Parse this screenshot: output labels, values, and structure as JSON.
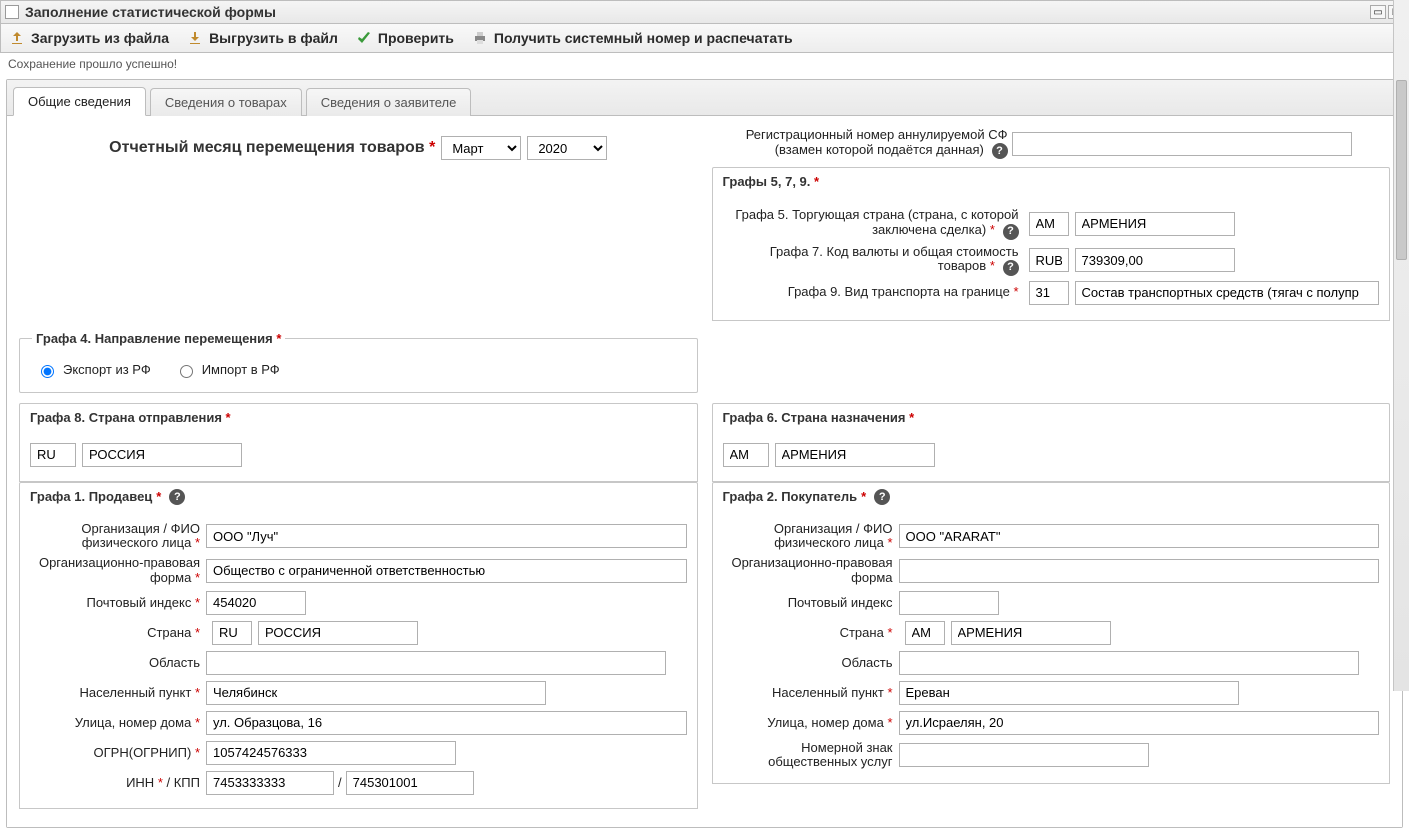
{
  "window": {
    "title": "Заполнение статистической формы"
  },
  "toolbar": {
    "load": "Загрузить из файла",
    "save": "Выгрузить в файл",
    "check": "Проверить",
    "print": "Получить системный номер и распечатать"
  },
  "status": "Сохранение прошло успешно!",
  "tabs": {
    "general": "Общие сведения",
    "goods": "Сведения о товарах",
    "applicant": "Сведения о заявителе"
  },
  "period": {
    "label": "Отчетный месяц перемещения товаров",
    "month": "Март",
    "year": "2020"
  },
  "reg": {
    "label1": "Регистрационный номер аннулируемой СФ",
    "label2": "(взамен которой подаётся данная)",
    "value": ""
  },
  "g579": {
    "title": "Графы 5, 7, 9.",
    "g5": {
      "label": "Графа 5. Торгующая страна (страна, с которой заключена сделка)",
      "code": "AM",
      "name": "АРМЕНИЯ"
    },
    "g7": {
      "label": "Графа 7. Код валюты и общая стоимость товаров",
      "code": "RUB",
      "value": "739309,00"
    },
    "g9": {
      "label": "Графа 9. Вид транспорта на границе",
      "code": "31",
      "name": "Состав транспортных средств (тягач с полупр"
    }
  },
  "g4": {
    "title": "Графа 4. Направление перемещения",
    "export": "Экспорт из РФ",
    "import": "Импорт в РФ",
    "selected": "export"
  },
  "g8": {
    "title": "Графа 8. Страна отправления",
    "code": "RU",
    "name": "РОССИЯ"
  },
  "g6": {
    "title": "Графа 6. Страна назначения",
    "code": "AM",
    "name": "АРМЕНИЯ"
  },
  "labels": {
    "org": "Организация / ФИО физического лица",
    "legal_form": "Организационно-правовая форма",
    "postal": "Почтовый индекс",
    "country": "Страна",
    "region": "Область",
    "city": "Населенный пункт",
    "street": "Улица, номер дома",
    "ogrn": "ОГРН(ОГРНИП)",
    "inn_kpp": "ИНН",
    "kpp_sep": " / КПП",
    "nzou": "Номерной знак общественных услуг"
  },
  "g1": {
    "title": "Графа 1. Продавец",
    "org": "ООО \"Луч\"",
    "legal_form": "Общество с ограниченной ответственностью",
    "postal": "454020",
    "country_code": "RU",
    "country_name": "РОССИЯ",
    "region": "",
    "city": "Челябинск",
    "street": "ул. Образцова, 16",
    "ogrn": "1057424576333",
    "inn": "7453333333",
    "kpp": "745301001"
  },
  "g2": {
    "title": "Графа 2. Покупатель",
    "org": "ООО \"ARARAT\"",
    "legal_form": "",
    "postal": "",
    "country_code": "AM",
    "country_name": "АРМЕНИЯ",
    "region": "",
    "city": "Ереван",
    "street": "ул.Исраелян, 20",
    "nzou": ""
  }
}
